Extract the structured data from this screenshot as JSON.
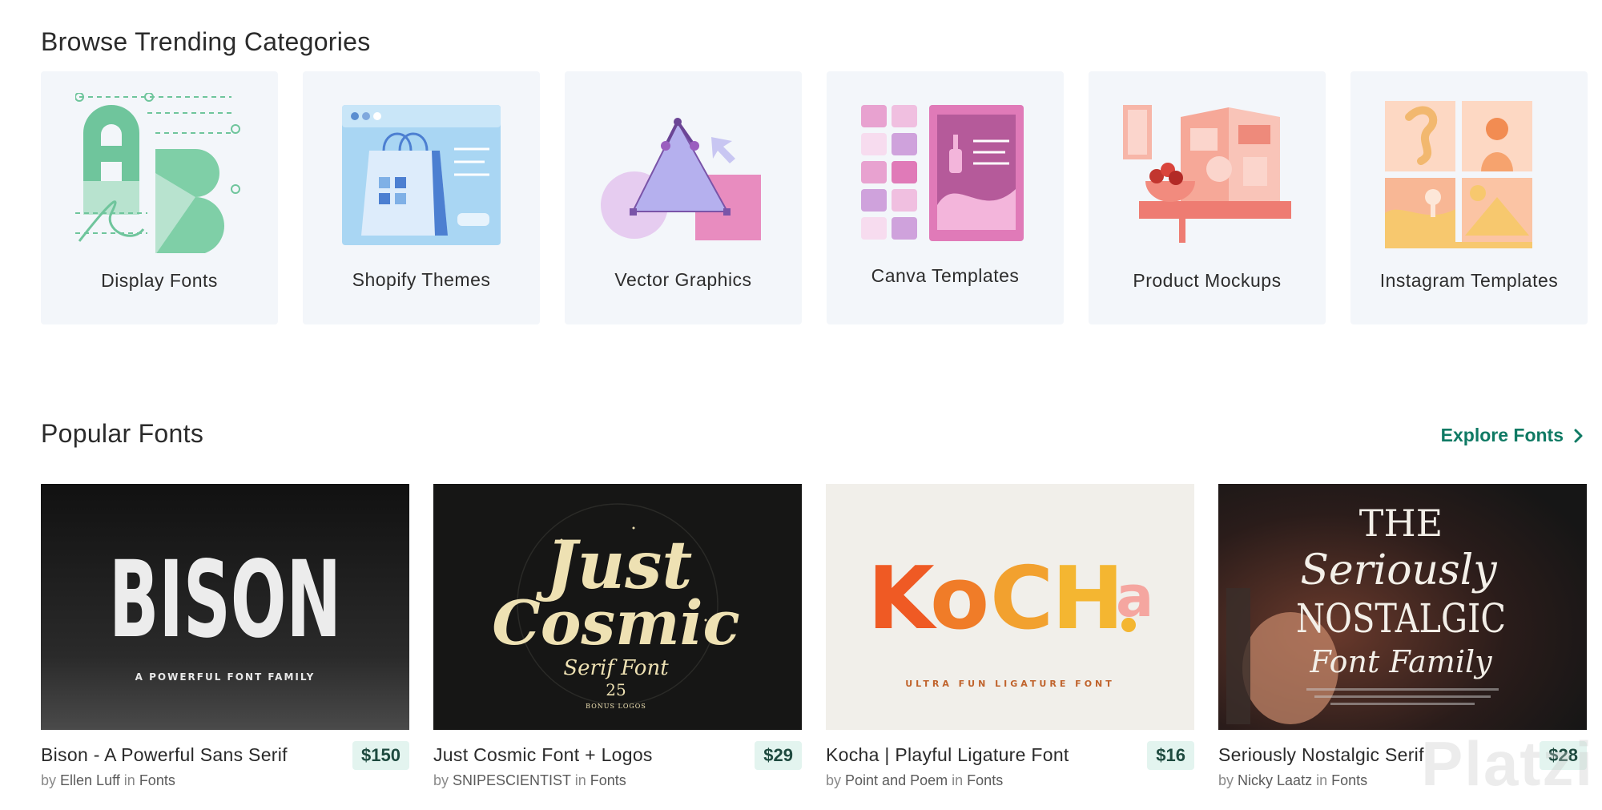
{
  "categories_section": {
    "title": "Browse Trending Categories",
    "items": [
      {
        "label": "Display Fonts",
        "icon": "display-fonts-illustration"
      },
      {
        "label": "Shopify Themes",
        "icon": "shopify-themes-illustration"
      },
      {
        "label": "Vector Graphics",
        "icon": "vector-graphics-illustration"
      },
      {
        "label": "Canva Templates",
        "icon": "canva-templates-illustration"
      },
      {
        "label": "Product Mockups",
        "icon": "product-mockups-illustration"
      },
      {
        "label": "Instagram Templates",
        "icon": "instagram-templates-illustration"
      }
    ]
  },
  "popular_fonts": {
    "title": "Popular Fonts",
    "explore_label": "Explore Fonts",
    "items": [
      {
        "title": "Bison - A Powerful Sans Serif",
        "price": "$150",
        "by": "by",
        "author": "Ellen Luff",
        "in": "in",
        "category": "Fonts",
        "preview_heading": "BISON",
        "preview_sub": "A POWERFUL FONT FAMILY"
      },
      {
        "title": "Just Cosmic Font + Logos",
        "price": "$29",
        "by": "by",
        "author": "SNIPESCIENTIST",
        "in": "in",
        "category": "Fonts",
        "preview_line1": "Just",
        "preview_line2": "Cosmic",
        "preview_sub": "Serif Font",
        "preview_num": "25",
        "preview_tag": "BONUS LOGOS"
      },
      {
        "title": "Kocha | Playful Ligature Font",
        "price": "$16",
        "by": "by",
        "author": "Point and Poem",
        "in": "in",
        "category": "Fonts",
        "preview_heading": "KOCHA",
        "preview_sub": "ULTRA FUN LIGATURE FONT"
      },
      {
        "title": "Seriously Nostalgic Serif",
        "price": "$28",
        "by": "by",
        "author": "Nicky Laatz",
        "in": "in",
        "category": "Fonts",
        "preview_line1": "THE",
        "preview_line2": "Seriously",
        "preview_line3": "NOSTALGIC",
        "preview_line4": "Font Family"
      }
    ]
  },
  "watermark": "Platzi",
  "colors": {
    "accent": "#0f7a64",
    "card_bg": "#f3f6fa",
    "price_bg": "#e3f4ef"
  }
}
